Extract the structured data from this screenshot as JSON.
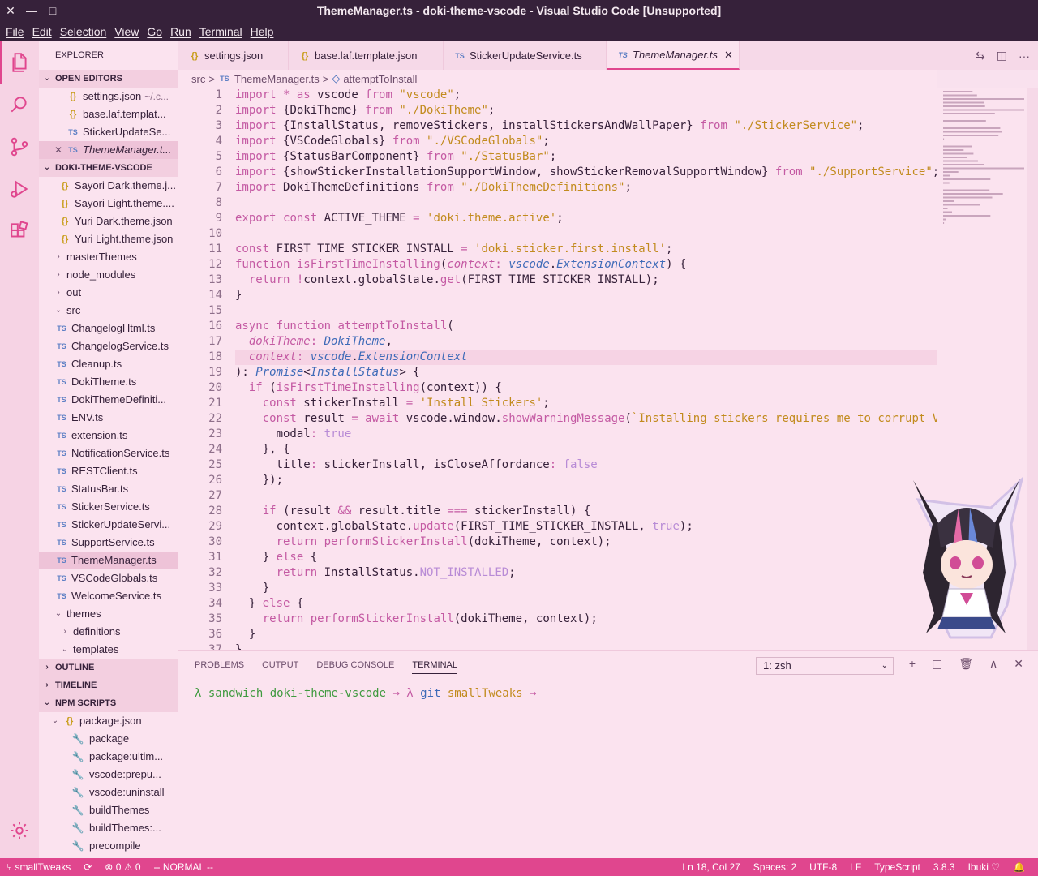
{
  "window": {
    "title": "ThemeManager.ts - doki-theme-vscode - Visual Studio Code [Unsupported]",
    "close": "✕",
    "minimize": "—",
    "maximize": "□"
  },
  "menu": [
    "File",
    "Edit",
    "Selection",
    "View",
    "Go",
    "Run",
    "Terminal",
    "Help"
  ],
  "sidebar": {
    "title": "EXPLORER",
    "open_editors": {
      "label": "OPEN EDITORS",
      "items": [
        {
          "icon": "{}",
          "label": "settings.json",
          "desc": "~/.c..."
        },
        {
          "icon": "{}",
          "label": "base.laf.templat..."
        },
        {
          "icon": "TS",
          "label": "StickerUpdateSe..."
        },
        {
          "icon": "TS",
          "label": "ThemeManager.t...",
          "close": "✕"
        }
      ]
    },
    "project": {
      "label": "DOKI-THEME-VSCODE",
      "items": [
        {
          "icon": "{}",
          "label": "Sayori Dark.theme.j..."
        },
        {
          "icon": "{}",
          "label": "Sayori Light.theme...."
        },
        {
          "icon": "{}",
          "label": "Yuri Dark.theme.json"
        },
        {
          "icon": "{}",
          "label": "Yuri Light.theme.json"
        },
        {
          "icon": "›",
          "label": "masterThemes"
        },
        {
          "icon": "›",
          "label": "node_modules"
        },
        {
          "icon": "›",
          "label": "out"
        },
        {
          "icon": "⌄",
          "label": "src"
        },
        {
          "icon": "TS",
          "label": "ChangelogHtml.ts"
        },
        {
          "icon": "TS",
          "label": "ChangelogService.ts"
        },
        {
          "icon": "TS",
          "label": "Cleanup.ts"
        },
        {
          "icon": "TS",
          "label": "DokiTheme.ts"
        },
        {
          "icon": "TS",
          "label": "DokiThemeDefiniti..."
        },
        {
          "icon": "TS",
          "label": "ENV.ts"
        },
        {
          "icon": "TS",
          "label": "extension.ts"
        },
        {
          "icon": "TS",
          "label": "NotificationService.ts"
        },
        {
          "icon": "TS",
          "label": "RESTClient.ts"
        },
        {
          "icon": "TS",
          "label": "StatusBar.ts"
        },
        {
          "icon": "TS",
          "label": "StickerService.ts"
        },
        {
          "icon": "TS",
          "label": "StickerUpdateServi..."
        },
        {
          "icon": "TS",
          "label": "SupportService.ts"
        },
        {
          "icon": "TS",
          "label": "ThemeManager.ts"
        },
        {
          "icon": "TS",
          "label": "VSCodeGlobals.ts"
        },
        {
          "icon": "TS",
          "label": "WelcomeService.ts"
        },
        {
          "icon": "⌄",
          "label": "themes"
        },
        {
          "icon": "›",
          "label": "definitions"
        },
        {
          "icon": "⌄",
          "label": "templates"
        }
      ]
    },
    "outline": "OUTLINE",
    "timeline": "TIMELINE",
    "npm": {
      "label": "NPM SCRIPTS",
      "package": "package.json",
      "package_icon": "{}",
      "scripts": [
        "package",
        "package:ultim...",
        "vscode:prepu...",
        "vscode:uninstall",
        "buildThemes",
        "buildThemes:...",
        "precompile"
      ]
    }
  },
  "tabs": [
    {
      "icon": "{}",
      "label": "settings.json"
    },
    {
      "icon": "{}",
      "label": "base.laf.template.json"
    },
    {
      "icon": "TS",
      "label": "StickerUpdateService.ts"
    },
    {
      "icon": "TS",
      "label": "ThemeManager.ts",
      "close": "✕"
    }
  ],
  "tab_actions": [
    "⇆",
    "◫",
    "···"
  ],
  "breadcrumb": {
    "folder": "src",
    "sep1": ">",
    "file_icon": "TS",
    "file": "ThemeManager.ts",
    "sep2": ">",
    "symbol_icon": "◇",
    "symbol": "attemptToInstall"
  },
  "editor": {
    "lines": [
      "1",
      "2",
      "3",
      "4",
      "5",
      "6",
      "7",
      "8",
      "9",
      "10",
      "11",
      "12",
      "13",
      "14",
      "15",
      "16",
      "17",
      "18",
      "19",
      "20",
      "21",
      "22",
      "23",
      "24",
      "25",
      "26",
      "27",
      "28",
      "29",
      "30",
      "31",
      "32",
      "33",
      "34",
      "35",
      "36",
      "37"
    ],
    "code": [
      [
        [
          "kw",
          "import "
        ],
        [
          "op",
          "* "
        ],
        [
          "kw",
          "as "
        ],
        [
          "",
          "vscode "
        ],
        [
          "kw",
          "from "
        ],
        [
          "str",
          "\"vscode\""
        ],
        [
          "",
          ";"
        ]
      ],
      [
        [
          "kw",
          "import "
        ],
        [
          "",
          "{DokiTheme} "
        ],
        [
          "kw",
          "from "
        ],
        [
          "str",
          "\"./DokiTheme\""
        ],
        [
          "",
          ";"
        ]
      ],
      [
        [
          "kw",
          "import "
        ],
        [
          "",
          "{InstallStatus, removeStickers, installStickersAndWallPaper} "
        ],
        [
          "kw",
          "from "
        ],
        [
          "str",
          "\"./StickerService\""
        ],
        [
          "",
          ";"
        ]
      ],
      [
        [
          "kw",
          "import "
        ],
        [
          "",
          "{VSCodeGlobals} "
        ],
        [
          "kw",
          "from "
        ],
        [
          "str",
          "\"./VSCodeGlobals\""
        ],
        [
          "",
          ";"
        ]
      ],
      [
        [
          "kw",
          "import "
        ],
        [
          "",
          "{StatusBarComponent} "
        ],
        [
          "kw",
          "from "
        ],
        [
          "str",
          "\"./StatusBar\""
        ],
        [
          "",
          ";"
        ]
      ],
      [
        [
          "kw",
          "import "
        ],
        [
          "",
          "{showStickerInstallationSupportWindow, showStickerRemovalSupportWindow} "
        ],
        [
          "kw",
          "from "
        ],
        [
          "str",
          "\"./SupportService\""
        ],
        [
          "",
          ";"
        ]
      ],
      [
        [
          "kw",
          "import "
        ],
        [
          "",
          "DokiThemeDefinitions "
        ],
        [
          "kw",
          "from "
        ],
        [
          "str",
          "\"./DokiThemeDefinitions\""
        ],
        [
          "",
          ";"
        ]
      ],
      [
        [
          "",
          ""
        ]
      ],
      [
        [
          "kw",
          "export "
        ],
        [
          "kw",
          "const "
        ],
        [
          "",
          "ACTIVE_THEME "
        ],
        [
          "op",
          "= "
        ],
        [
          "str",
          "'doki.theme.active'"
        ],
        [
          "",
          ";"
        ]
      ],
      [
        [
          "",
          ""
        ]
      ],
      [
        [
          "kw",
          "const "
        ],
        [
          "",
          "FIRST_TIME_STICKER_INSTALL "
        ],
        [
          "op",
          "= "
        ],
        [
          "str",
          "'doki.sticker.first.install'"
        ],
        [
          "",
          ";"
        ]
      ],
      [
        [
          "kw",
          "function "
        ],
        [
          "fn",
          "isFirstTimeInstalling"
        ],
        [
          "",
          "("
        ],
        [
          "it",
          "context"
        ],
        [
          "op",
          ": "
        ],
        [
          "ty",
          "vscode"
        ],
        [
          "",
          "."
        ],
        [
          "ty",
          "ExtensionContext"
        ],
        [
          "",
          ") {"
        ]
      ],
      [
        [
          "",
          "  "
        ],
        [
          "kw",
          "return "
        ],
        [
          "op",
          "!"
        ],
        [
          "",
          "context.globalState."
        ],
        [
          "fn",
          "get"
        ],
        [
          "",
          "(FIRST_TIME_STICKER_INSTALL);"
        ]
      ],
      [
        [
          "",
          "}"
        ]
      ],
      [
        [
          "",
          ""
        ]
      ],
      [
        [
          "kw",
          "async "
        ],
        [
          "kw",
          "function "
        ],
        [
          "fn",
          "attemptToInstall"
        ],
        [
          "",
          "("
        ]
      ],
      [
        [
          "",
          "  "
        ],
        [
          "it",
          "dokiTheme"
        ],
        [
          "op",
          ": "
        ],
        [
          "ty",
          "DokiTheme"
        ],
        [
          "",
          ","
        ]
      ],
      [
        [
          "",
          "  "
        ],
        [
          "it",
          "context"
        ],
        [
          "op",
          ": "
        ],
        [
          "ty",
          "vscode"
        ],
        [
          "",
          "."
        ],
        [
          "ty",
          "ExtensionContext"
        ]
      ],
      [
        [
          "",
          "): "
        ],
        [
          "ty",
          "Promise"
        ],
        [
          "",
          "<"
        ],
        [
          "ty",
          "InstallStatus"
        ],
        [
          "",
          "> {"
        ]
      ],
      [
        [
          "",
          "  "
        ],
        [
          "kw",
          "if "
        ],
        [
          "",
          "("
        ],
        [
          "fn",
          "isFirstTimeInstalling"
        ],
        [
          "",
          "(context)) {"
        ]
      ],
      [
        [
          "",
          "    "
        ],
        [
          "kw",
          "const "
        ],
        [
          "",
          "stickerInstall "
        ],
        [
          "op",
          "= "
        ],
        [
          "str",
          "'Install Stickers'"
        ],
        [
          "",
          ";"
        ]
      ],
      [
        [
          "",
          "    "
        ],
        [
          "kw",
          "const "
        ],
        [
          "",
          "result "
        ],
        [
          "op",
          "= "
        ],
        [
          "kw",
          "await "
        ],
        [
          "",
          "vscode.window."
        ],
        [
          "fn",
          "showWarningMessage"
        ],
        [
          "",
          "("
        ],
        [
          "str",
          "`Installing stickers requires me to corrupt V"
        ]
      ],
      [
        [
          "",
          "      modal"
        ],
        [
          "op",
          ": "
        ],
        [
          "cst",
          "true"
        ]
      ],
      [
        [
          "",
          "    }, {"
        ]
      ],
      [
        [
          "",
          "      title"
        ],
        [
          "op",
          ": "
        ],
        [
          "",
          "stickerInstall, isCloseAffordance"
        ],
        [
          "op",
          ": "
        ],
        [
          "cst",
          "false"
        ]
      ],
      [
        [
          "",
          "    });"
        ]
      ],
      [
        [
          "",
          ""
        ]
      ],
      [
        [
          "",
          "    "
        ],
        [
          "kw",
          "if "
        ],
        [
          "",
          "(result "
        ],
        [
          "op",
          "&& "
        ],
        [
          "",
          "result.title "
        ],
        [
          "op",
          "=== "
        ],
        [
          "",
          "stickerInstall) {"
        ]
      ],
      [
        [
          "",
          "      context.globalState."
        ],
        [
          "fn",
          "update"
        ],
        [
          "",
          "(FIRST_TIME_STICKER_INSTALL, "
        ],
        [
          "cst",
          "true"
        ],
        [
          "",
          ");"
        ]
      ],
      [
        [
          "",
          "      "
        ],
        [
          "kw",
          "return "
        ],
        [
          "fn",
          "performStickerInstall"
        ],
        [
          "",
          "(dokiTheme, context);"
        ]
      ],
      [
        [
          "",
          "    } "
        ],
        [
          "kw",
          "else "
        ],
        [
          "",
          "{"
        ]
      ],
      [
        [
          "",
          "      "
        ],
        [
          "kw",
          "return "
        ],
        [
          "",
          "InstallStatus."
        ],
        [
          "cst",
          "NOT_INSTALLED"
        ],
        [
          "",
          ";"
        ]
      ],
      [
        [
          "",
          "    }"
        ]
      ],
      [
        [
          "",
          "  } "
        ],
        [
          "kw",
          "else "
        ],
        [
          "",
          "{"
        ]
      ],
      [
        [
          "",
          "    "
        ],
        [
          "kw",
          "return "
        ],
        [
          "fn",
          "performStickerInstall"
        ],
        [
          "",
          "(dokiTheme, context);"
        ]
      ],
      [
        [
          "",
          "  }"
        ]
      ],
      [
        [
          "",
          "}"
        ]
      ]
    ]
  },
  "panel": {
    "tabs": [
      "PROBLEMS",
      "OUTPUT",
      "DEBUG CONSOLE",
      "TERMINAL"
    ],
    "terminal_select": "1: zsh",
    "actions": [
      "+",
      "◫",
      "🗑",
      "∧",
      "✕"
    ],
    "terminal": {
      "prompt1": "λ ",
      "user": "sandwich ",
      "dir": "doki-theme-vscode ",
      "arrow1": "→ ",
      "prompt2": "λ ",
      "git": "git ",
      "branch": "smallTweaks ",
      "arrow2": "→"
    }
  },
  "status": {
    "branch": "smallTweaks",
    "sync": "⟳",
    "errors": "0",
    "warnings": "0",
    "mode": "-- NORMAL --",
    "position": "Ln 18, Col 27",
    "spaces": "Spaces: 2",
    "encoding": "UTF-8",
    "eol": "LF",
    "language": "TypeScript",
    "version": "3.8.3",
    "theme": "Ibuki"
  },
  "colors": {
    "accent": "#e0468e",
    "titlebar": "#36213a",
    "background": "#fbe3ef"
  }
}
